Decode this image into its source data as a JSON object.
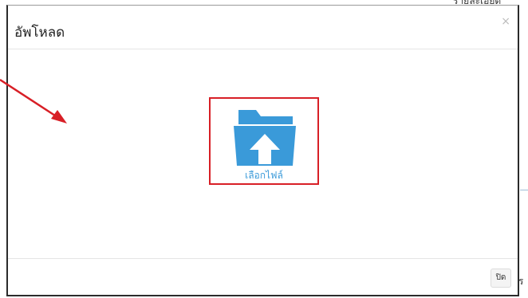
{
  "background": {
    "top_right_text": "รายละเอียด",
    "bottom_right_letter": "ร"
  },
  "modal": {
    "title": "อัพโหลด",
    "close_symbol": "×",
    "upload": {
      "label": "เลือกไฟล์",
      "icon": "folder-upload-icon",
      "icon_color": "#3a9ad9",
      "highlight_color": "#d81f26"
    },
    "footer": {
      "close_label": "ปิด"
    }
  },
  "annotation": {
    "arrow_color": "#d81f26"
  }
}
